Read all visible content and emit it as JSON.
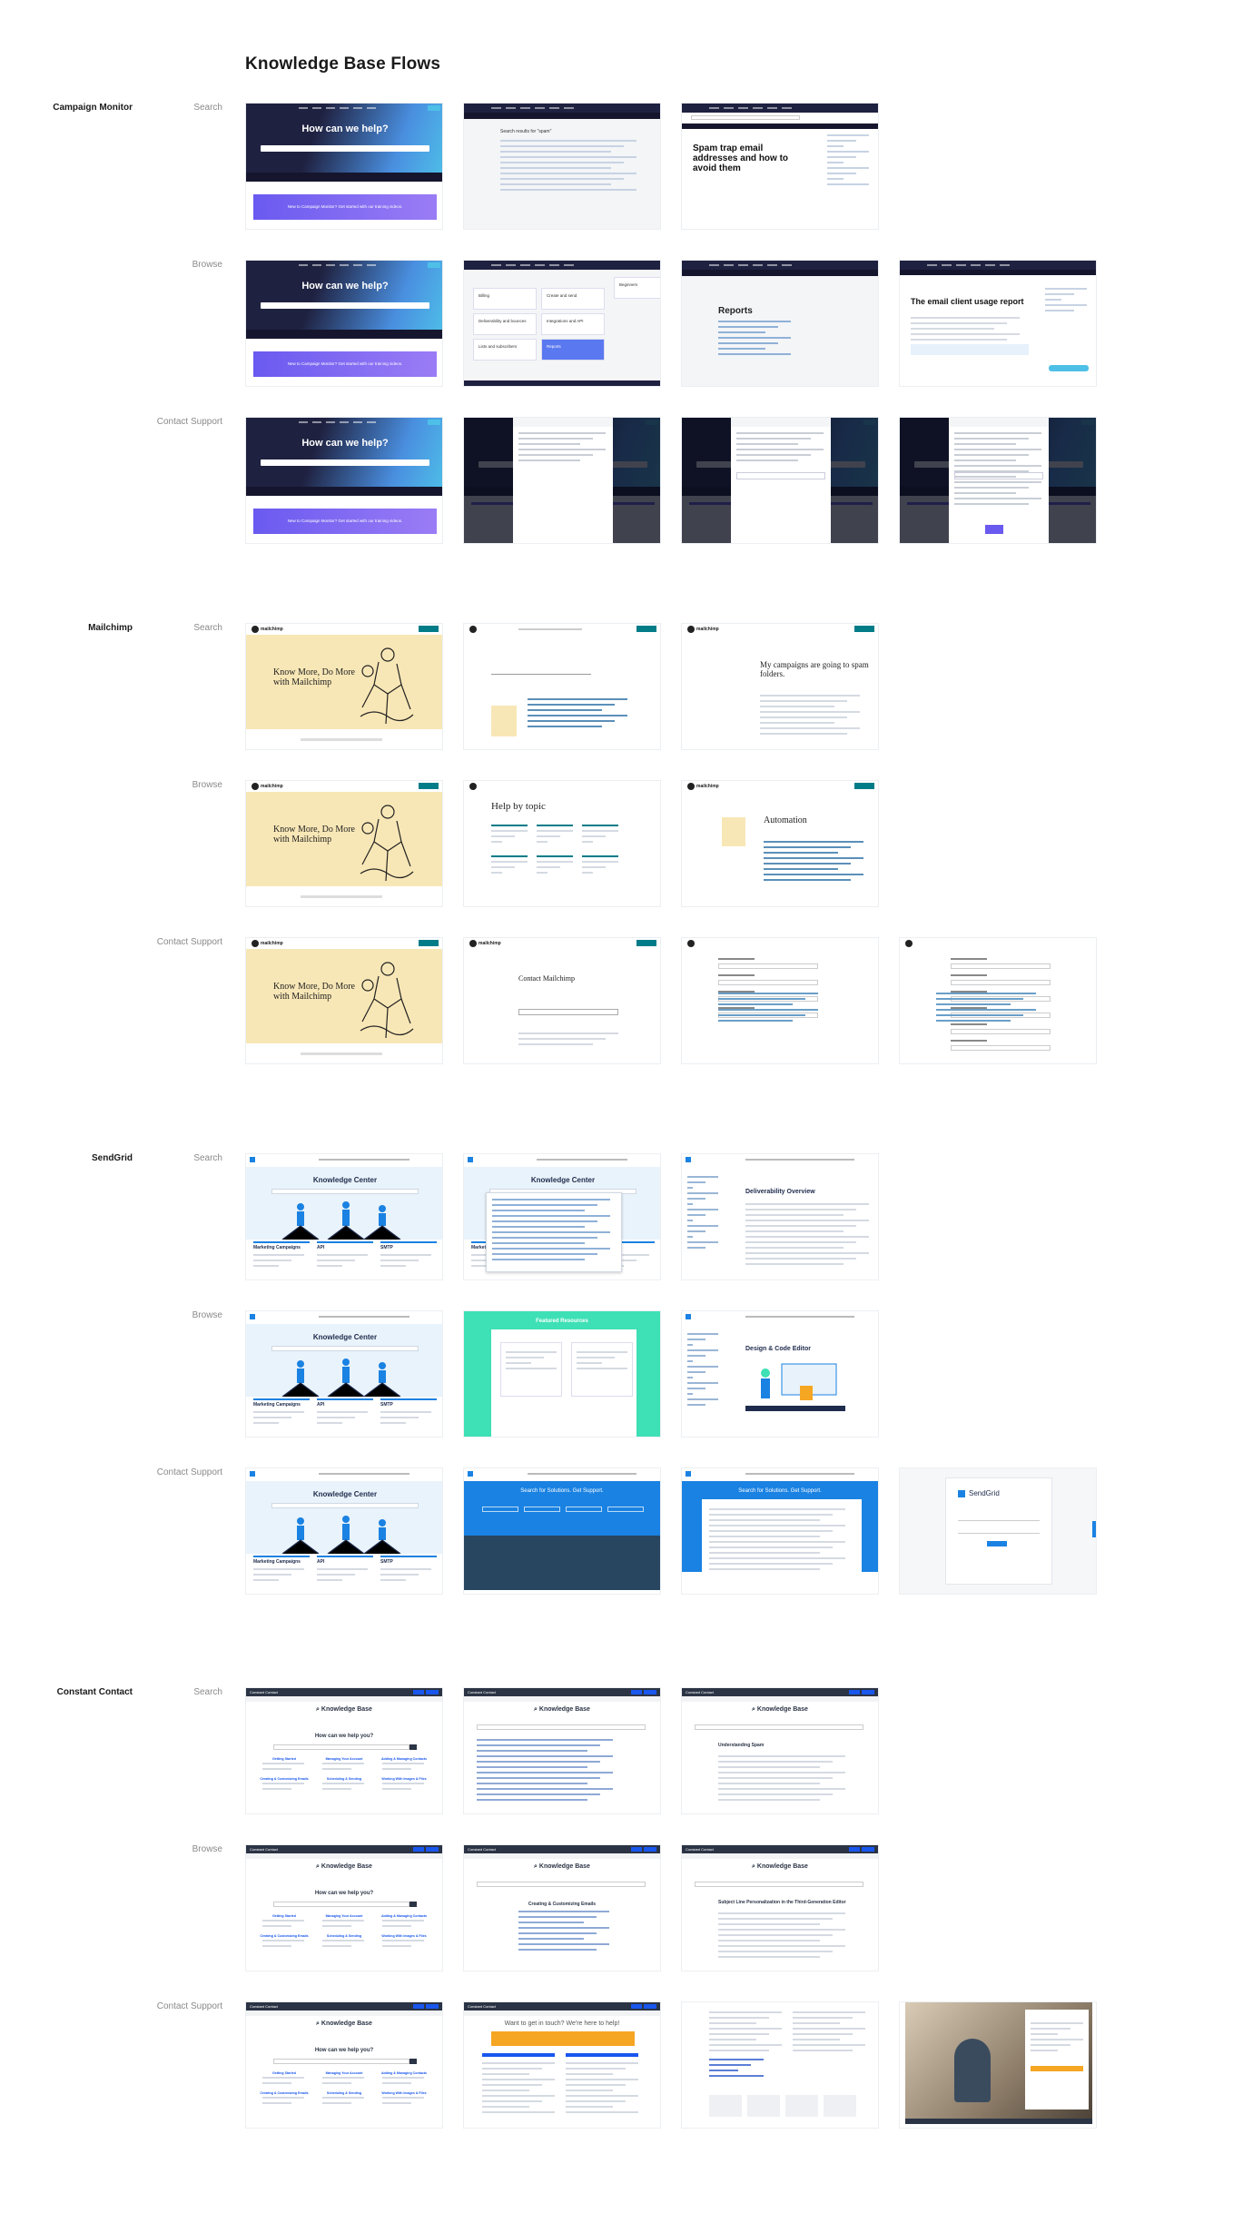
{
  "page": {
    "title": "Knowledge Base Flows"
  },
  "colors": {
    "cm_navy": "#1f2140",
    "cm_blue": "#4a8fe0",
    "cm_cyan": "#4ec0e8",
    "cm_purple": "#6a5af0",
    "mc_yellow": "#f8e7b6",
    "mc_teal": "#007c89",
    "sg_blue": "#1a82e2",
    "sg_light": "#e9f3fb",
    "sg_mint": "#3ee0b5",
    "cc_navy": "#2b3445",
    "cc_blue": "#1856ed",
    "cc_orange": "#f5a623"
  },
  "companies": [
    {
      "name": "Campaign Monitor",
      "flows": [
        "Search",
        "Browse",
        "Contact Support"
      ]
    },
    {
      "name": "Mailchimp",
      "flows": [
        "Search",
        "Browse",
        "Contact Support"
      ]
    },
    {
      "name": "SendGrid",
      "flows": [
        "Search",
        "Browse",
        "Contact Support"
      ]
    },
    {
      "name": "Constant Contact",
      "flows": [
        "Search",
        "Browse",
        "Contact Support"
      ]
    }
  ],
  "screens": {
    "cm_hero": "How can we help?",
    "cm_banner": "New to Campaign Monitor? Get started with our training videos.",
    "cm_results": "Search results for \"spam\"",
    "cm_article": "Spam trap email addresses and how to avoid them",
    "cm_browse_cats": [
      "Billing",
      "Create and send",
      "Beginners",
      "Deliverability and bounces",
      "Integrations and API",
      "Lists and subscribers",
      "Reports"
    ],
    "cm_reports": "Reports",
    "cm_usage": "The email client usage report",
    "mc_hero": "Know More, Do More with Mailchimp",
    "mc_article": "My campaigns are going to spam folders.",
    "mc_topic": "Help by topic",
    "mc_automation": "Automation",
    "mc_contact": "Contact Mailchimp",
    "mc_logo": "mailchimp",
    "sg_hero": "Knowledge Center",
    "sg_cards": [
      "Marketing Campaigns",
      "API",
      "SMTP"
    ],
    "sg_deliverability": "Deliverability Overview",
    "sg_design": "Design & Code Editor",
    "sg_support": "Search for Solutions. Get Support.",
    "sg_logo": "SendGrid",
    "cc_kb": "Knowledge Base",
    "cc_help": "How can we help you?",
    "cc_spam": "Understanding Spam",
    "cc_contact": "Want to get in touch? We're here to help!",
    "cc_subject": "Subject Line Personalization in the Third-Generation Editor",
    "cc_topics": [
      "Getting Started",
      "Managing Your Account",
      "Adding & Managing Contacts",
      "Creating & Customizing Emails",
      "Scheduling & Sending",
      "Working With Images & Files"
    ]
  }
}
